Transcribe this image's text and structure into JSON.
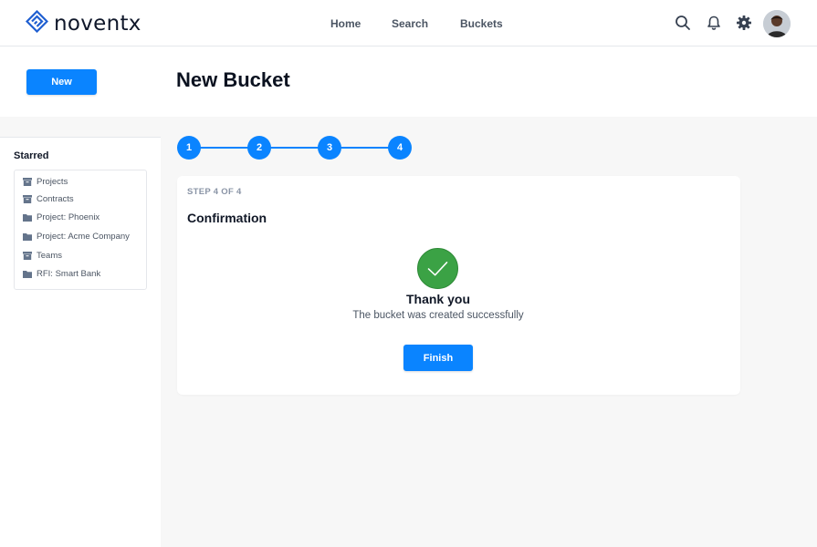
{
  "brand": {
    "name": "noventx",
    "logo_icon": "noventx-logo-icon",
    "accent": "#0a84ff"
  },
  "nav": {
    "home": "Home",
    "search": "Search",
    "buckets": "Buckets"
  },
  "header_icons": [
    "search-icon",
    "bell-icon",
    "gear-icon",
    "avatar"
  ],
  "actions": {
    "new_label": "New"
  },
  "page": {
    "title": "New Bucket"
  },
  "sidebar": {
    "starred_title": "Starred",
    "items": [
      {
        "label": "Projects",
        "icon": "archive-icon"
      },
      {
        "label": "Contracts",
        "icon": "archive-icon"
      },
      {
        "label": "Project: Phoenix",
        "icon": "folder-icon"
      },
      {
        "label": "Project: Acme Company",
        "icon": "folder-icon"
      },
      {
        "label": "Teams",
        "icon": "archive-icon"
      },
      {
        "label": "RFI: Smart Bank",
        "icon": "folder-icon"
      }
    ]
  },
  "stepper": {
    "steps": [
      "1",
      "2",
      "3",
      "4"
    ],
    "current": 4
  },
  "wizard": {
    "step_label": "STEP 4 OF 4",
    "title": "Confirmation",
    "success_color": "#3ba245",
    "thanks": "Thank you",
    "message": "The bucket was created successfully",
    "finish_label": "Finish"
  }
}
